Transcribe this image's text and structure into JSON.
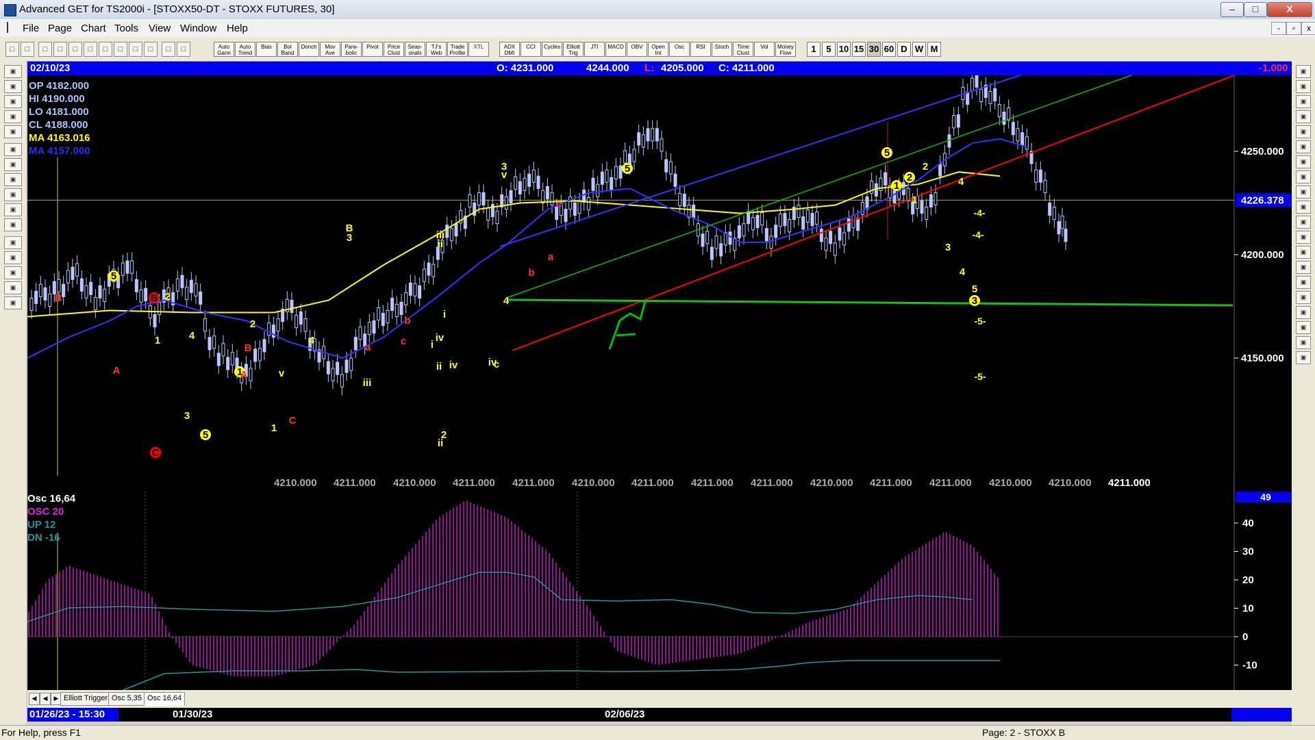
{
  "window": {
    "title": "Advanced GET for TS2000i - [STOXX50-DT - STOXX FUTURES, 30]",
    "min": "–",
    "max": "□",
    "close": "X"
  },
  "menu": [
    "File",
    "Page",
    "Chart",
    "Tools",
    "View",
    "Window",
    "Help"
  ],
  "mdi_buttons": [
    "-",
    "▫",
    "x"
  ],
  "toolbar": {
    "indicators": [
      [
        "Auto",
        "Gann"
      ],
      [
        "Auto",
        "Trend"
      ],
      [
        "Bias",
        ""
      ],
      [
        "Bol",
        "Band"
      ],
      [
        "Donch",
        ""
      ],
      [
        "Mov",
        "Ave"
      ],
      [
        "Para-",
        "bolic"
      ],
      [
        "Pivot",
        ""
      ],
      [
        "Price",
        "Clust"
      ],
      [
        "Seas-",
        "onals"
      ],
      [
        "TJ's",
        "Web"
      ],
      [
        "Trade",
        "Profile"
      ],
      [
        "XTL",
        ""
      ],
      [
        "ADX",
        "DMI"
      ],
      [
        "CCI",
        ""
      ],
      [
        "Cycles",
        ""
      ],
      [
        "Elliott",
        "Trig"
      ],
      [
        "JTI",
        ""
      ],
      [
        "MACD",
        ""
      ],
      [
        "OBV",
        ""
      ],
      [
        "Open",
        "Int"
      ],
      [
        "Osc",
        ""
      ],
      [
        "RSI",
        ""
      ],
      [
        "Stoch",
        ""
      ],
      [
        "Time",
        "Clust"
      ],
      [
        "Vol",
        ""
      ],
      [
        "Money",
        "Flow"
      ]
    ],
    "timeframes": [
      "1",
      "5",
      "10",
      "15",
      "30",
      "60",
      "D",
      "W",
      "M"
    ],
    "selected_timeframe": "30"
  },
  "header": {
    "date": "02/10/23",
    "open": "O: 4231.000",
    "high": "4244.000",
    "low_label": "L:",
    "low": "4205.000",
    "close": "C: 4211.000",
    "change": "-1.000"
  },
  "info": {
    "op": "OP  4182.000",
    "hi": "HI   4190.000",
    "lo": "LO  4181.000",
    "cl": "CL  4188.000",
    "ma1": "MA  4163.016",
    "ma2": "MA  4157.000"
  },
  "price_axis": {
    "ticks": [
      {
        "label": "4250.000",
        "value": 4250
      },
      {
        "label": "4200.000",
        "value": 4200
      },
      {
        "label": "4150.000",
        "value": 4150
      }
    ],
    "current": {
      "label": "4226.378",
      "value": 4226.378
    }
  },
  "bottom_prices": [
    {
      "label": "4210.000",
      "x": 0.13
    },
    {
      "label": "4211.000",
      "x": 0.21
    },
    {
      "label": "4210.000",
      "x": 0.29
    },
    {
      "label": "4211.000",
      "x": 0.37
    },
    {
      "label": "4211.000",
      "x": 0.45
    },
    {
      "label": "4210.000",
      "x": 0.53
    },
    {
      "label": "4211.000",
      "x": 0.61
    },
    {
      "label": "4211.000",
      "x": 0.69
    },
    {
      "label": "4211.000",
      "x": 0.77
    },
    {
      "label": "4210.000",
      "x": 0.85
    },
    {
      "label": "4211.000",
      "x": 0.93
    },
    {
      "label": "4211.000",
      "x": 1.01
    },
    {
      "label": "4210.000",
      "x": 1.09
    },
    {
      "label": "4210.000",
      "x": 1.17
    },
    {
      "label": "4211.000",
      "x": 1.25
    }
  ],
  "wave_labels": {
    "yellow": [
      "5",
      "2",
      "1",
      "4",
      "3",
      "5",
      "1",
      "2",
      "B",
      "3",
      "4",
      "1",
      "v",
      "iii",
      "ii",
      "iv",
      "i",
      "i",
      "iv",
      "ii",
      "2",
      "c",
      "4",
      "3",
      "v",
      "iii",
      "ii",
      "iv",
      "5",
      "1",
      "2",
      "2",
      "1",
      "4",
      "3",
      "4",
      "5",
      "3",
      "5"
    ],
    "red": [
      "B",
      "B",
      "C",
      "A",
      "B",
      "A",
      "C",
      "c",
      "a",
      "b",
      "b",
      "c",
      "a"
    ],
    "projections": [
      "-4-",
      "-4-",
      "-5-",
      "-5-"
    ]
  },
  "oscillator": {
    "title": "Osc 16,64",
    "osc": "OSC 20",
    "up": "UP   12",
    "dn": "DN   -16",
    "value_badge": "49",
    "ticks": [
      {
        "label": "40",
        "value": 40
      },
      {
        "label": "30",
        "value": 30
      },
      {
        "label": "20",
        "value": 20
      },
      {
        "label": "10",
        "value": 10
      },
      {
        "label": "0",
        "value": 0
      },
      {
        "label": "-10",
        "value": -10
      }
    ]
  },
  "tabs": [
    "Elliott Trigger",
    "Osc 5,35",
    "Osc 16,64"
  ],
  "active_tab": "Osc 16,64",
  "dates": {
    "cursor": "01/26/23 - 15:30",
    "d1": "01/30/23",
    "d2": "02/06/23"
  },
  "status": {
    "help": "For Help, press F1",
    "page": "Page: 2 - STOXX B"
  },
  "colors": {
    "header_blue": "#0000ee",
    "candle": "#b8c8ff",
    "ma_yellow": "#ffff00",
    "ma_blue": "#3333ff",
    "channel_green": "#00c000",
    "channel_red": "#ff0000",
    "osc_magenta": "#e020e0",
    "osc_teal": "#1a9a9a"
  }
}
